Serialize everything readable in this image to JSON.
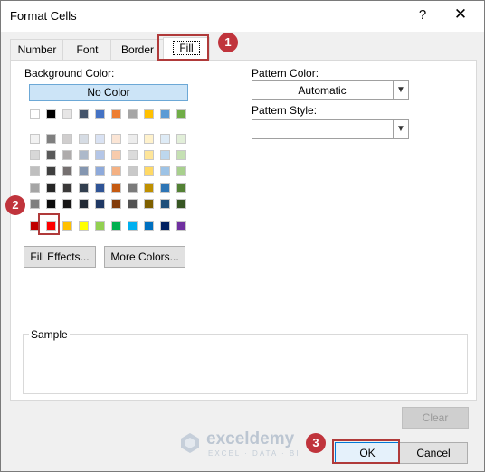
{
  "window": {
    "title": "Format Cells",
    "help_glyph": "?",
    "close_glyph": "✕"
  },
  "tabs": [
    {
      "label": "Number"
    },
    {
      "label": "Font"
    },
    {
      "label": "Border"
    },
    {
      "label": "Fill",
      "selected": true
    }
  ],
  "fill": {
    "background_color_label": "Background Color:",
    "no_color_label": "No Color",
    "selected_swatch": "Red (standard)",
    "pattern_color_label": "Pattern Color:",
    "pattern_color_value": "Automatic",
    "pattern_style_label": "Pattern Style:",
    "pattern_style_value": "",
    "fill_effects_label": "Fill Effects...",
    "more_colors_label": "More Colors...",
    "sample_label": "Sample",
    "clear_label": "Clear"
  },
  "palette": {
    "theme_row": [
      "#ffffff",
      "#000000",
      "#e7e6e6",
      "#44546a",
      "#4472c4",
      "#ed7d31",
      "#a5a5a5",
      "#ffc000",
      "#5b9bd5",
      "#70ad47"
    ],
    "tints": [
      [
        "#f2f2f2",
        "#7f7f7f",
        "#d0cece",
        "#d6dce4",
        "#d9e2f3",
        "#fbe5d5",
        "#ededed",
        "#fff2cc",
        "#deebf6",
        "#e2efd9"
      ],
      [
        "#d8d8d8",
        "#595959",
        "#aeabab",
        "#adb9ca",
        "#b4c6e7",
        "#f7cbac",
        "#dbdbdb",
        "#fee599",
        "#bdd7ee",
        "#c5e0b3"
      ],
      [
        "#bfbfbf",
        "#3f3f3f",
        "#757070",
        "#8496b0",
        "#8eaadb",
        "#f4b183",
        "#c9c9c9",
        "#ffd965",
        "#9dc3e6",
        "#a8d08d"
      ],
      [
        "#a5a5a5",
        "#262626",
        "#3a3838",
        "#323f4f",
        "#2f5496",
        "#c55a11",
        "#7b7b7b",
        "#bf9000",
        "#2e75b5",
        "#538135"
      ],
      [
        "#7f7f7f",
        "#0c0c0c",
        "#171616",
        "#222a35",
        "#1f3864",
        "#833c0b",
        "#525252",
        "#7f6000",
        "#1e4e79",
        "#375623"
      ]
    ],
    "standard_row": [
      "#c00000",
      "#ff0000",
      "#ffc000",
      "#ffff00",
      "#92d050",
      "#00b050",
      "#00b0f0",
      "#0070c0",
      "#002060",
      "#7030a0"
    ]
  },
  "footer": {
    "ok_label": "OK",
    "cancel_label": "Cancel"
  },
  "annotations": {
    "step1": "1",
    "step2": "2",
    "step3": "3"
  },
  "watermark": {
    "name": "exceldemy",
    "tagline": "EXCEL · DATA · BI"
  }
}
